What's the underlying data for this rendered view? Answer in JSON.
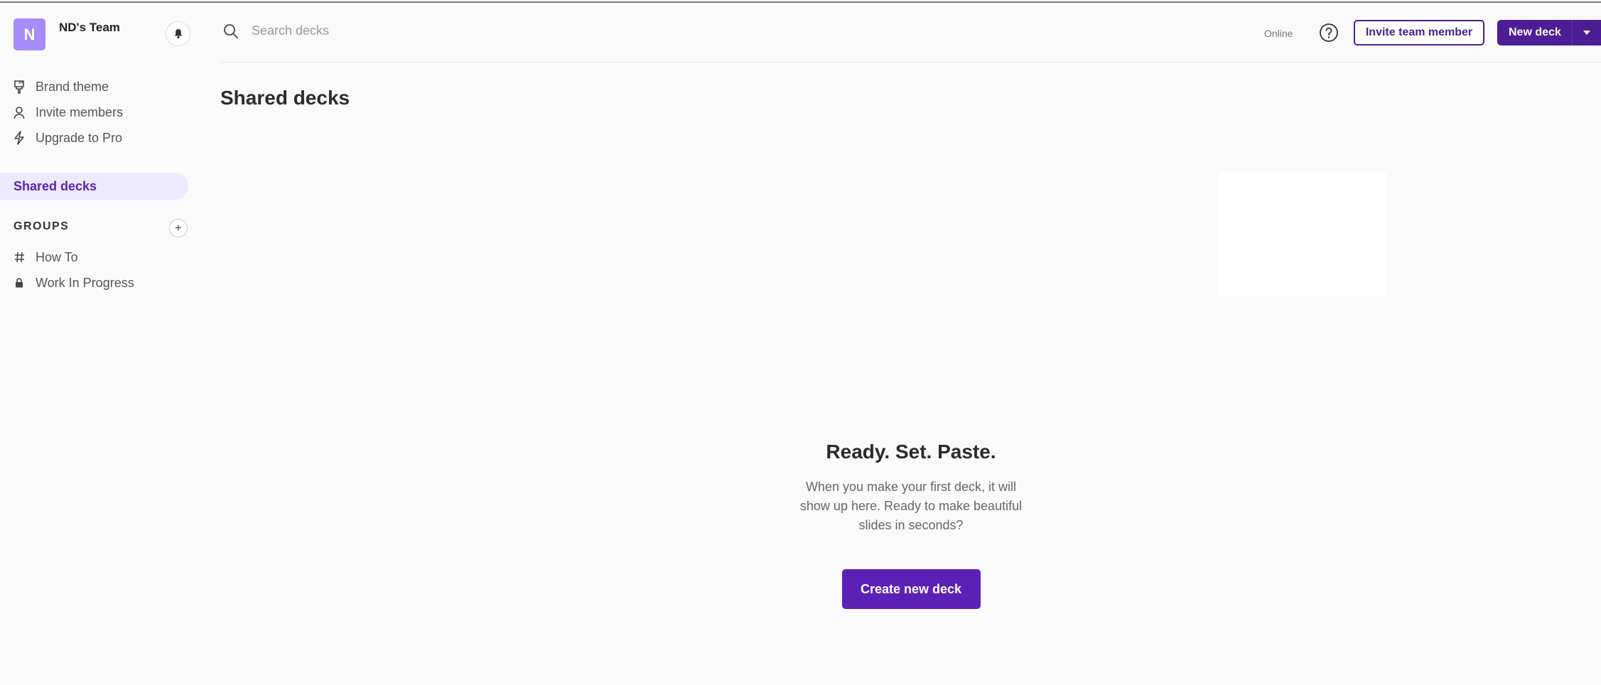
{
  "team": {
    "initial": "N",
    "name": "ND's Team"
  },
  "sidebar": {
    "menu": [
      {
        "label": "Brand theme",
        "icon": "paint-brush-icon"
      },
      {
        "label": "Invite members",
        "icon": "person-icon"
      },
      {
        "label": "Upgrade to Pro",
        "icon": "lightning-icon"
      }
    ],
    "active_item": "Shared decks",
    "groups_heading": "GROUPS",
    "groups": [
      {
        "label": "How To",
        "icon": "hash-icon"
      },
      {
        "label": "Work In Progress",
        "icon": "lock-icon"
      }
    ]
  },
  "topbar": {
    "search_placeholder": "Search decks",
    "status": "Online",
    "invite_label": "Invite team member",
    "new_deck_label": "New deck"
  },
  "main": {
    "title": "Shared decks",
    "empty_title": "Ready. Set. Paste.",
    "empty_text": "When you make your first deck, it will show up here. Ready to make beautiful slides in seconds?",
    "create_label": "Create new deck"
  },
  "colors": {
    "accent": "#4c1d95",
    "active_bg": "#ede9fe",
    "avatar": "#a78bfa"
  }
}
